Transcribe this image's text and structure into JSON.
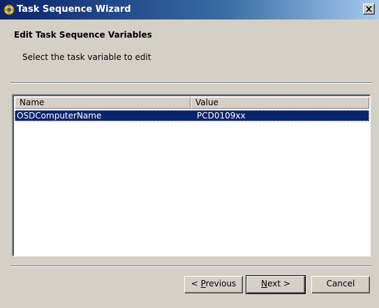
{
  "window": {
    "title": "Task Sequence Wizard"
  },
  "header": {
    "title": "Edit Task Sequence Variables",
    "subtitle": "Select the task variable to edit"
  },
  "list": {
    "columns": [
      "Name",
      "Value"
    ],
    "rows": [
      {
        "name": "OSDComputerName",
        "value": "PCD0109xx",
        "selected": true
      }
    ]
  },
  "buttons": {
    "previous": {
      "pre": "< ",
      "accel": "P",
      "post": "revious"
    },
    "next": {
      "accel": "N",
      "post": "ext >"
    },
    "cancel": "Cancel"
  },
  "colors": {
    "selection": "#0a246a",
    "dialog_bg": "#d4d0c8"
  }
}
